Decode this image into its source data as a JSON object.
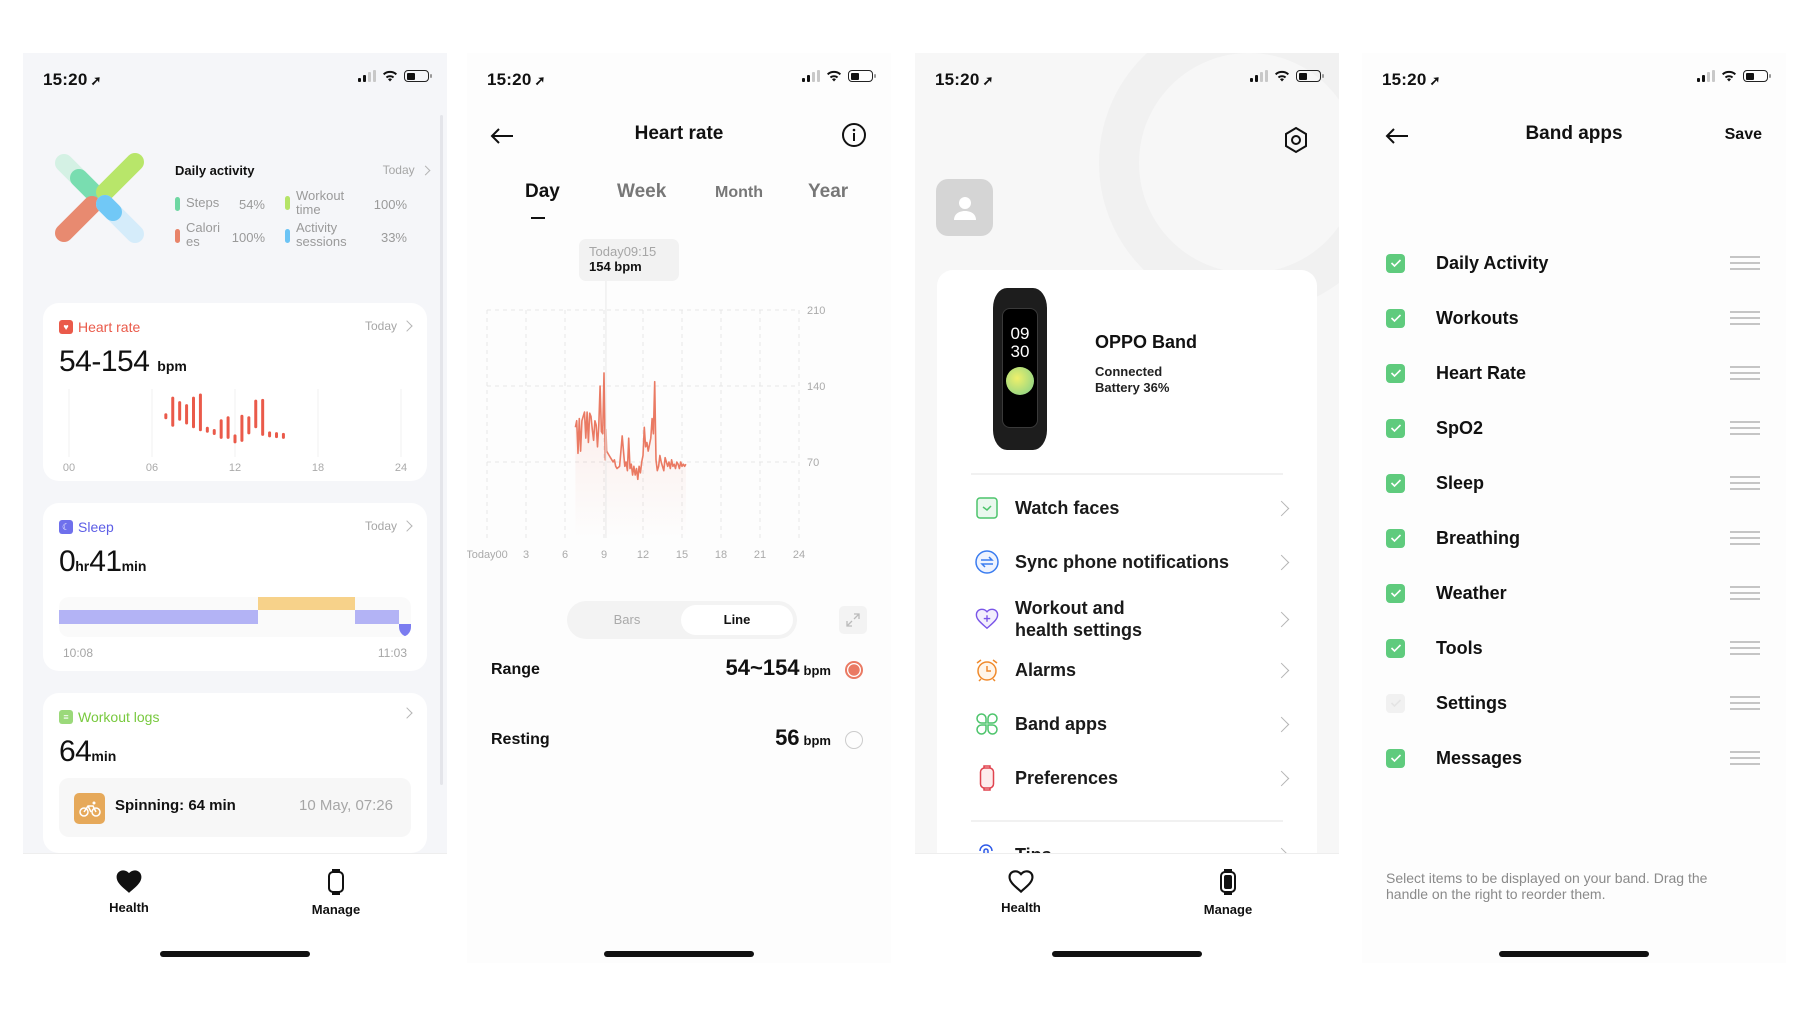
{
  "status_bar": {
    "time": "15:20"
  },
  "health_screen": {
    "daily_activity": {
      "title": "Daily activity",
      "period": "Today",
      "metrics": [
        {
          "label": "Steps",
          "value": "54%",
          "color": "#6fd7a3"
        },
        {
          "label": "Calori\nes",
          "value": "100%",
          "color": "#e8846a"
        },
        {
          "label": "Workout\ntime",
          "value": "100%",
          "color": "#b5e468"
        },
        {
          "label": "Activity\nsessions",
          "value": "33%",
          "color": "#6cc4f5"
        }
      ]
    },
    "heart_rate": {
      "title": "Heart rate",
      "period": "Today",
      "value": "54-154",
      "unit": "bpm",
      "x_ticks": [
        "00",
        "06",
        "12",
        "18",
        "24"
      ],
      "bars": [
        {
          "hour": 7.0,
          "lo": 92,
          "hi": 96
        },
        {
          "hour": 7.5,
          "lo": 82,
          "hi": 118
        },
        {
          "hour": 8.0,
          "lo": 90,
          "hi": 112
        },
        {
          "hour": 8.5,
          "lo": 85,
          "hi": 108
        },
        {
          "hour": 9.0,
          "lo": 80,
          "hi": 118
        },
        {
          "hour": 9.5,
          "lo": 76,
          "hi": 122
        },
        {
          "hour": 10.0,
          "lo": 74,
          "hi": 78
        },
        {
          "hour": 10.5,
          "lo": 72,
          "hi": 75
        },
        {
          "hour": 11.0,
          "lo": 66,
          "hi": 88
        },
        {
          "hour": 11.5,
          "lo": 66,
          "hi": 92
        },
        {
          "hour": 12.0,
          "lo": 60,
          "hi": 68
        },
        {
          "hour": 12.5,
          "lo": 62,
          "hi": 94
        },
        {
          "hour": 13.0,
          "lo": 72,
          "hi": 92
        },
        {
          "hour": 13.5,
          "lo": 80,
          "hi": 114
        },
        {
          "hour": 14.0,
          "lo": 70,
          "hi": 115
        },
        {
          "hour": 14.5,
          "lo": 68,
          "hi": 72
        },
        {
          "hour": 15.0,
          "lo": 67,
          "hi": 71
        },
        {
          "hour": 15.5,
          "lo": 66,
          "hi": 70
        }
      ]
    },
    "sleep": {
      "title": "Sleep",
      "period": "Today",
      "hours": "0",
      "hours_unit": "hr",
      "minutes": "41",
      "minutes_unit": "min",
      "start": "10:08",
      "end": "11:03",
      "segments": [
        {
          "stage": "light",
          "from": 0.0,
          "to": 0.565,
          "color": "#b3b3f5"
        },
        {
          "stage": "awake",
          "from": 0.565,
          "to": 0.84,
          "color": "#f7d28a"
        },
        {
          "stage": "light",
          "from": 0.84,
          "to": 0.965,
          "color": "#b3b3f5"
        },
        {
          "stage": "deep",
          "from": 0.965,
          "to": 1.0,
          "color": "#7b7cf0"
        }
      ]
    },
    "workout_logs": {
      "title": "Workout logs",
      "value": "64",
      "unit": "min",
      "entry": {
        "label": "Spinning: 64 min",
        "date": "10 May, 07:26",
        "icon": "bike-icon"
      }
    },
    "tabs": [
      {
        "label": "Health",
        "icon": "heart-filled-icon",
        "active": true
      },
      {
        "label": "Manage",
        "icon": "watch-icon",
        "active": false
      }
    ]
  },
  "heart_rate_screen": {
    "title": "Heart rate",
    "period_tabs": [
      {
        "label": "Day",
        "active": true
      },
      {
        "label": "Week",
        "active": false
      },
      {
        "label": "Month",
        "active": false
      },
      {
        "label": "Year",
        "active": false
      }
    ],
    "tooltip": {
      "time": "Today09:15",
      "value": "154 bpm"
    },
    "view_toggle": [
      {
        "label": "Bars",
        "active": false
      },
      {
        "label": "Line",
        "active": true
      }
    ],
    "stats": [
      {
        "label": "Range",
        "value": "54~154",
        "unit": "bpm",
        "selected": true
      },
      {
        "label": "Resting",
        "value": "56",
        "unit": "bpm",
        "selected": false
      }
    ]
  },
  "chart_data": {
    "type": "line",
    "title": "Heart rate",
    "xlabel": "",
    "ylabel": "bpm",
    "x_tick_labels": [
      "Today00",
      "3",
      "6",
      "9",
      "12",
      "15",
      "18",
      "21",
      "24"
    ],
    "x_ticks": [
      0,
      3,
      6,
      9,
      12,
      15,
      18,
      21,
      24
    ],
    "y_ticks": [
      70,
      140,
      210
    ],
    "xlim": [
      0,
      24
    ],
    "ylim": [
      0,
      210
    ],
    "grid": true,
    "series": [
      {
        "name": "Heart rate",
        "color": "#ea7a63",
        "x": [
          6.8,
          6.9,
          7.0,
          7.1,
          7.2,
          7.3,
          7.4,
          7.5,
          7.6,
          7.7,
          7.8,
          7.9,
          8.0,
          8.1,
          8.2,
          8.3,
          8.4,
          8.5,
          8.6,
          8.7,
          8.8,
          8.9,
          9.0,
          9.1,
          9.15,
          9.2,
          9.3,
          9.4,
          9.5,
          9.6,
          9.7,
          9.8,
          9.9,
          10.0,
          10.2,
          10.4,
          10.6,
          10.7,
          10.8,
          10.9,
          11.0,
          11.1,
          11.2,
          11.3,
          11.4,
          11.5,
          11.6,
          11.7,
          11.8,
          11.9,
          12.0,
          12.1,
          12.2,
          12.3,
          12.4,
          12.5,
          12.6,
          12.7,
          12.8,
          12.9,
          13.0,
          13.1,
          13.2,
          13.3,
          13.4,
          13.5,
          13.6,
          13.7,
          13.8,
          13.9,
          14.0,
          14.1,
          14.2,
          14.3,
          14.4,
          14.5,
          14.6,
          14.7,
          14.8,
          14.9,
          15.0,
          15.1,
          15.2,
          15.3
        ],
        "y": [
          102,
          108,
          78,
          110,
          80,
          108,
          112,
          116,
          92,
          116,
          88,
          115,
          112,
          100,
          90,
          108,
          104,
          84,
          104,
          140,
          98,
          96,
          152,
          72,
          100,
          80,
          78,
          76,
          74,
          72,
          70,
          72,
          66,
          64,
          66,
          94,
          66,
          70,
          62,
          92,
          64,
          68,
          58,
          66,
          58,
          64,
          54,
          66,
          60,
          70,
          76,
          102,
          84,
          88,
          80,
          86,
          92,
          110,
          96,
          144,
          72,
          62,
          66,
          76,
          70,
          66,
          62,
          74,
          70,
          66,
          70,
          64,
          72,
          66,
          68,
          64,
          70,
          68,
          64,
          70,
          66,
          68,
          66,
          68
        ]
      }
    ]
  },
  "manage_screen": {
    "device": {
      "name": "OPPO Band",
      "status": "Connected",
      "battery": "Battery 36%",
      "face_time_top": "09",
      "face_time_bottom": "30"
    },
    "menu": [
      {
        "label": "Watch faces",
        "icon": "watch-face-icon",
        "color": "#4cc46b"
      },
      {
        "label": "Sync phone notifications",
        "icon": "sync-icon",
        "color": "#3a7cf0"
      },
      {
        "label": "Workout and\nhealth settings",
        "icon": "heart-plus-icon",
        "color": "#7a55e8"
      },
      {
        "label": "Alarms",
        "icon": "alarm-icon",
        "color": "#f08a2c"
      },
      {
        "label": "Band apps",
        "icon": "apps-icon",
        "color": "#4cc46b"
      },
      {
        "label": "Preferences",
        "icon": "band-icon",
        "color": "#e0434f"
      },
      {
        "label": "Tips",
        "icon": "touch-icon",
        "color": "#2f5be8"
      }
    ],
    "tabs": [
      {
        "label": "Health",
        "icon": "heart-outline-icon",
        "active": false
      },
      {
        "label": "Manage",
        "icon": "watch-filled-icon",
        "active": true
      }
    ]
  },
  "band_apps_screen": {
    "title": "Band apps",
    "save_label": "Save",
    "apps": [
      {
        "label": "Daily Activity",
        "checked": true
      },
      {
        "label": "Workouts",
        "checked": true
      },
      {
        "label": "Heart Rate",
        "checked": true
      },
      {
        "label": "SpO2",
        "checked": true
      },
      {
        "label": "Sleep",
        "checked": true
      },
      {
        "label": "Breathing",
        "checked": true
      },
      {
        "label": "Weather",
        "checked": true
      },
      {
        "label": "Tools",
        "checked": true
      },
      {
        "label": "Settings",
        "checked": false
      },
      {
        "label": "Messages",
        "checked": true
      }
    ],
    "hint": "Select items to be displayed on your band. Drag the handle on the right to reorder them."
  }
}
